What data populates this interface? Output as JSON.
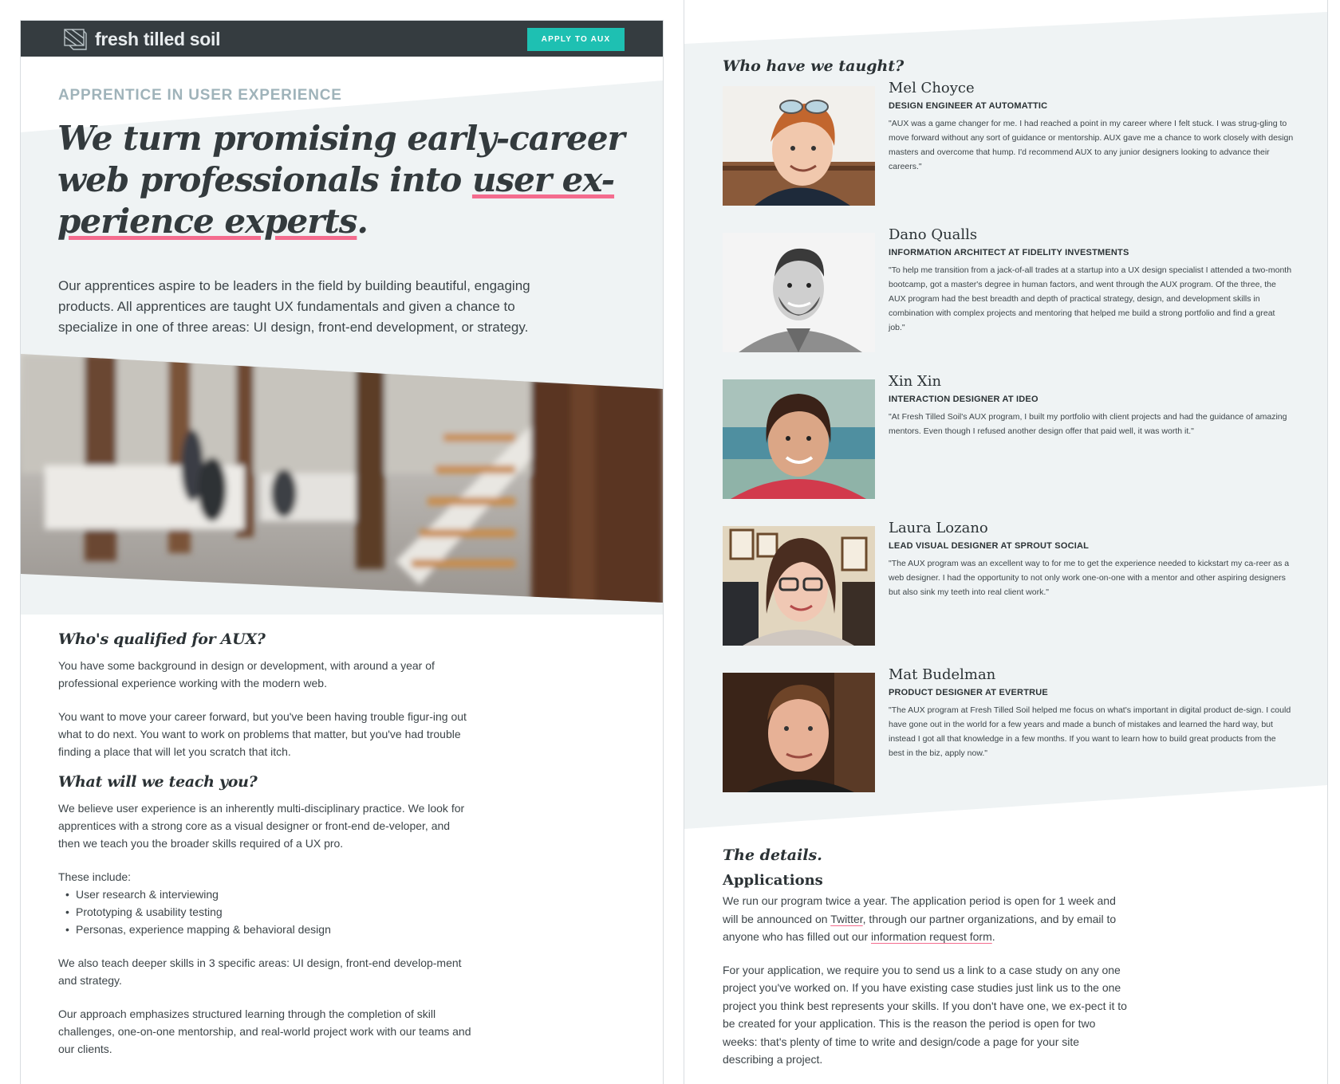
{
  "header": {
    "brand": "fresh tilled soil",
    "apply_label": "APPLY TO AUX"
  },
  "hero": {
    "eyebrow": "APPRENTICE IN USER EXPERIENCE",
    "headline_a": "We turn promising early-career web professionals into ",
    "headline_b": "user ex-perience experts",
    "headline_c": ".",
    "intro": "Our apprentices aspire to be leaders in the field by building beautiful, engaging products. All apprentices are taught UX fundamentals and given a chance to specialize in one of three areas: UI design, front-end development, or strategy."
  },
  "qualified": {
    "title": "Who's qualified for AUX?",
    "p1": "You have some background in design or development, with around a year of professional experience working with the modern web.",
    "p2": "You want to move your career forward, but you've been having trouble figur-ing out what to do next. You want to work on problems that matter, but you've had trouble finding a place that will let you scratch that itch."
  },
  "teach": {
    "title": "What will we teach you?",
    "p1": "We believe user experience is an inherently multi-disciplinary practice. We look for apprentices with a strong core as a visual designer or front-end de-veloper, and then we teach you the broader skills required of a UX pro.",
    "includes": "These include:",
    "bullets": [
      "User research & interviewing",
      "Prototyping & usability testing",
      "Personas, experience mapping & behavioral design"
    ],
    "p2": "We also teach deeper skills in 3 specific areas: UI design, front-end develop-ment and strategy.",
    "p3": "Our approach emphasizes structured learning through the completion of skill challenges, one-on-one mentorship, and real-world project work with our teams and our clients."
  },
  "taught": {
    "title": "Who have we taught?",
    "people": [
      {
        "name": "Mel Choyce",
        "role": "DESIGN ENGINEER AT AUTOMATTIC",
        "quote": "\"AUX was a game changer for me. I had reached a point in my career where I felt stuck. I was strug-gling to move forward without any sort of guidance or mentorship. AUX gave me a chance to work closely with design masters and overcome that hump. I'd recommend AUX to any junior designers looking to advance their careers.\""
      },
      {
        "name": "Dano Qualls",
        "role": "INFORMATION ARCHITECT AT FIDELITY INVESTMENTS",
        "quote": "\"To help me transition from a jack-of-all trades at a startup into a UX design specialist I attended a two-month bootcamp, got a master's degree in human factors, and went through the AUX program. Of the three, the AUX program had the best breadth and depth of practical strategy, design, and development skills in combination with complex projects and mentoring that helped me build a strong portfolio and find a great job.\""
      },
      {
        "name": "Xin Xin",
        "role": "INTERACTION DESIGNER AT IDEO",
        "quote": "\"At Fresh Tilled Soil's AUX program, I built my portfolio with client projects and had the guidance of amazing mentors. Even though I refused another design offer that paid well, it was worth it.\""
      },
      {
        "name": "Laura Lozano",
        "role": "LEAD VISUAL DESIGNER AT SPROUT SOCIAL",
        "quote": "\"The AUX program was an excellent way to for me to get the experience needed to kickstart my ca-reer as a web designer. I had the opportunity to not only work one-on-one with a mentor and other aspiring designers but also sink my teeth into real client work.\""
      },
      {
        "name": "Mat Budelman",
        "role": "PRODUCT DESIGNER AT EVERTRUE",
        "quote": "\"The AUX program at Fresh Tilled Soil helped me focus on what's important in digital product de-sign. I could have gone out in the world for a few years and made a bunch of mistakes and learned the hard way, but instead I got all that knowledge in a few months. If you want to learn how to build great products from the best in the biz, apply now.\""
      }
    ]
  },
  "details": {
    "title": "The details.",
    "apps_title": "Applications",
    "p1_a": "We run our program twice a year. The application period is open for 1 week and will be announced on ",
    "twitter": "Twitter",
    "p1_b": ", through our partner organizations, and by email to anyone who has filled out our ",
    "form_link": "information request form",
    "p1_c": ".",
    "p2": "For your application, we require you to send us a link to a case study on any one project you've worked on. If you have existing case studies just link us to the one project you think best represents your skills. If you don't have one, we ex-pect it to be created for your application. This is the reason the period is open for two weeks: that's plenty of time to write and design/code a page for your site describing a project."
  },
  "colors": {
    "accent": "#1ec0b2",
    "underline": "#f46c8e",
    "hero_bg": "#eff3f4",
    "topbar": "#353c40"
  }
}
